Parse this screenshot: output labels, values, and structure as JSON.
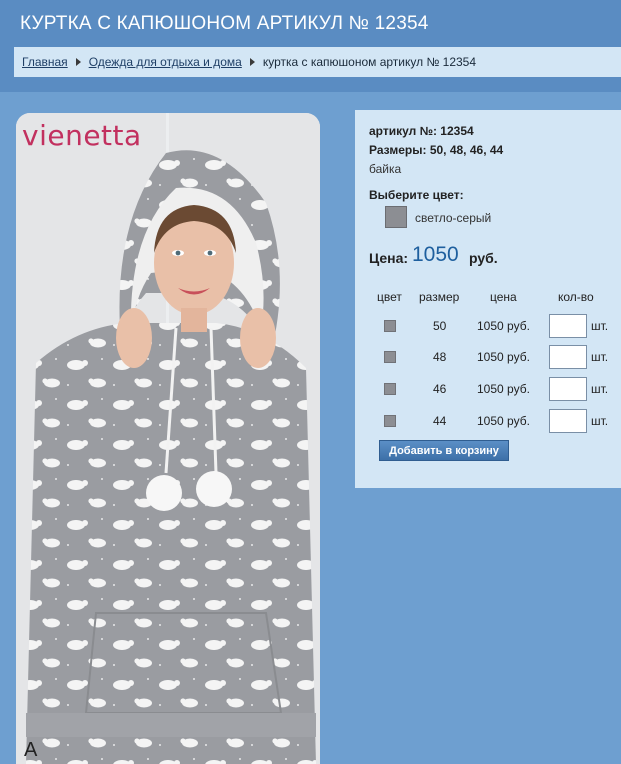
{
  "header": {
    "title": "КУРТКА С КАПЮШОНОМ АРТИКУЛ № 12354",
    "breadcrumb": [
      {
        "label": "Главная"
      },
      {
        "label": "Одежда для отдыха и дома"
      },
      {
        "label": "куртка с капюшоном артикул № 12354"
      }
    ]
  },
  "image": {
    "brand": "vienetta",
    "corner_letter": "A"
  },
  "product": {
    "article_label": "артикул №:",
    "article_value": "12354",
    "sizes_label": "Размеры:",
    "sizes_value": "50, 48, 46, 44",
    "material": "байка",
    "choose_color_label": "Выберите цвет:",
    "color_name": "светло-серый",
    "color_hex": "#8c8e93",
    "price_label": "Цена:",
    "price_value": "1050",
    "price_currency": "руб."
  },
  "variants": {
    "headers": [
      "цвет",
      "размер",
      "цена",
      "кол-во"
    ],
    "rows": [
      {
        "size": "50",
        "price": "1050 руб.",
        "qty": "",
        "unit": "шт."
      },
      {
        "size": "48",
        "price": "1050 руб.",
        "qty": "",
        "unit": "шт."
      },
      {
        "size": "46",
        "price": "1050 руб.",
        "qty": "",
        "unit": "шт."
      },
      {
        "size": "44",
        "price": "1050 руб.",
        "qty": "",
        "unit": "шт."
      }
    ]
  },
  "actions": {
    "add_to_cart": "Добавить в корзину"
  }
}
